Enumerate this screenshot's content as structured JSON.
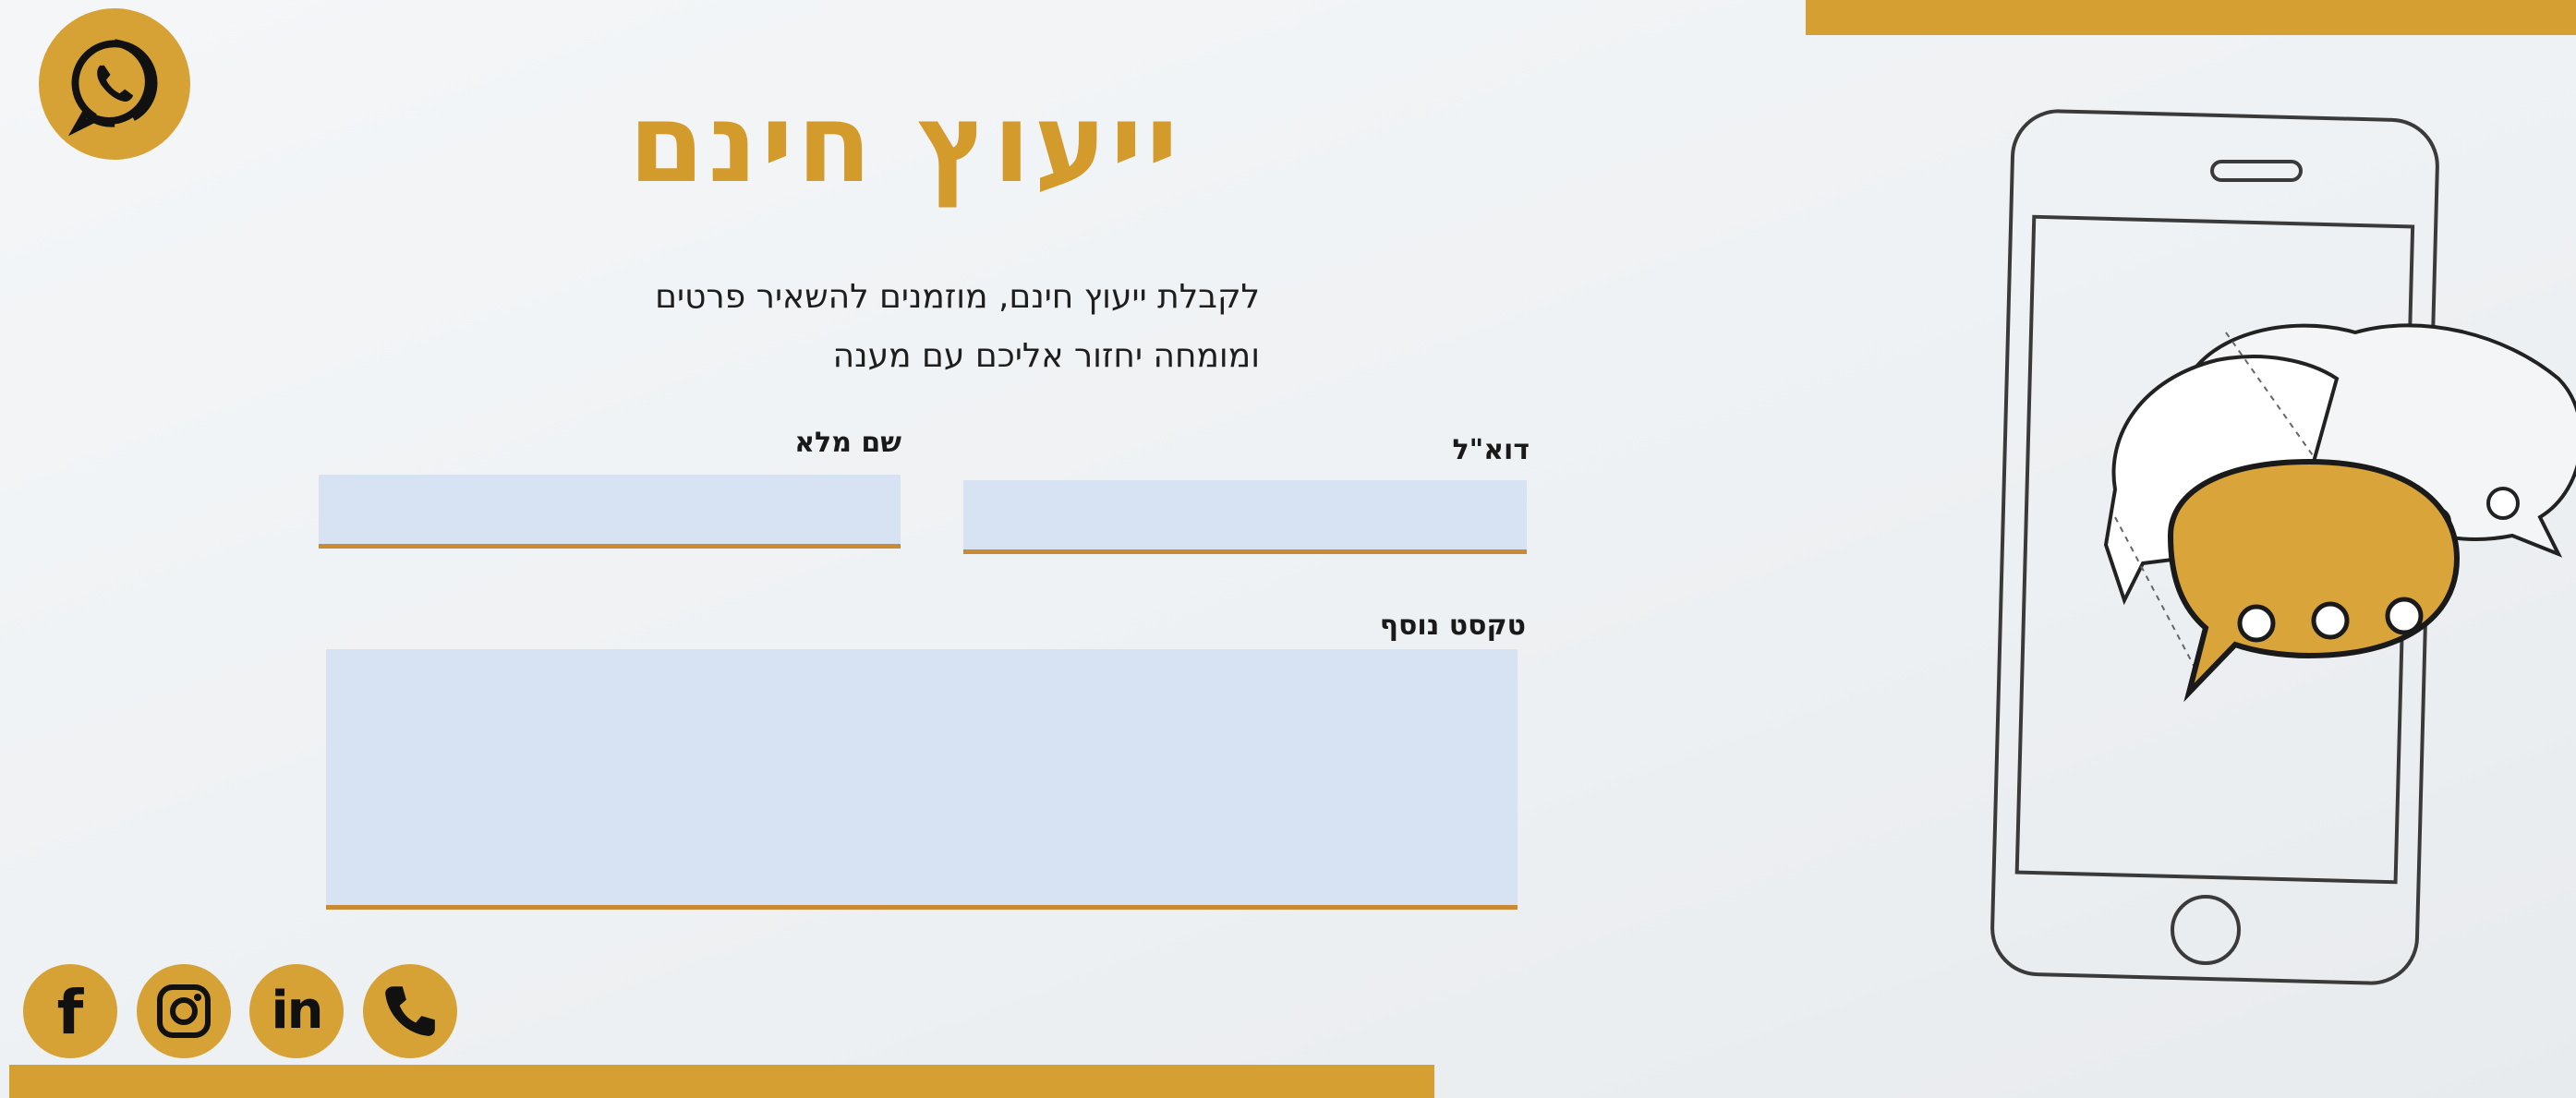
{
  "header": {
    "title": "ייעוץ חינם",
    "description_line1": "לקבלת ייעוץ חינם, מוזמנים להשאיר פרטים",
    "description_line2": "ומומחה יחזור אליכם עם מענה"
  },
  "form": {
    "email_label": "דוא\"ל",
    "email_value": "",
    "name_label": "שם מלא",
    "name_value": "",
    "extra_label": "טקסט נוסף",
    "extra_value": ""
  },
  "contact": {
    "whatsapp_icon": "whatsapp-icon",
    "social_icons": [
      "facebook-icon",
      "instagram-icon",
      "linkedin-icon",
      "phone-icon"
    ]
  },
  "colors": {
    "accent": "#d5a031",
    "field_background": "#d7e2f2",
    "field_underline": "#c98a33"
  }
}
